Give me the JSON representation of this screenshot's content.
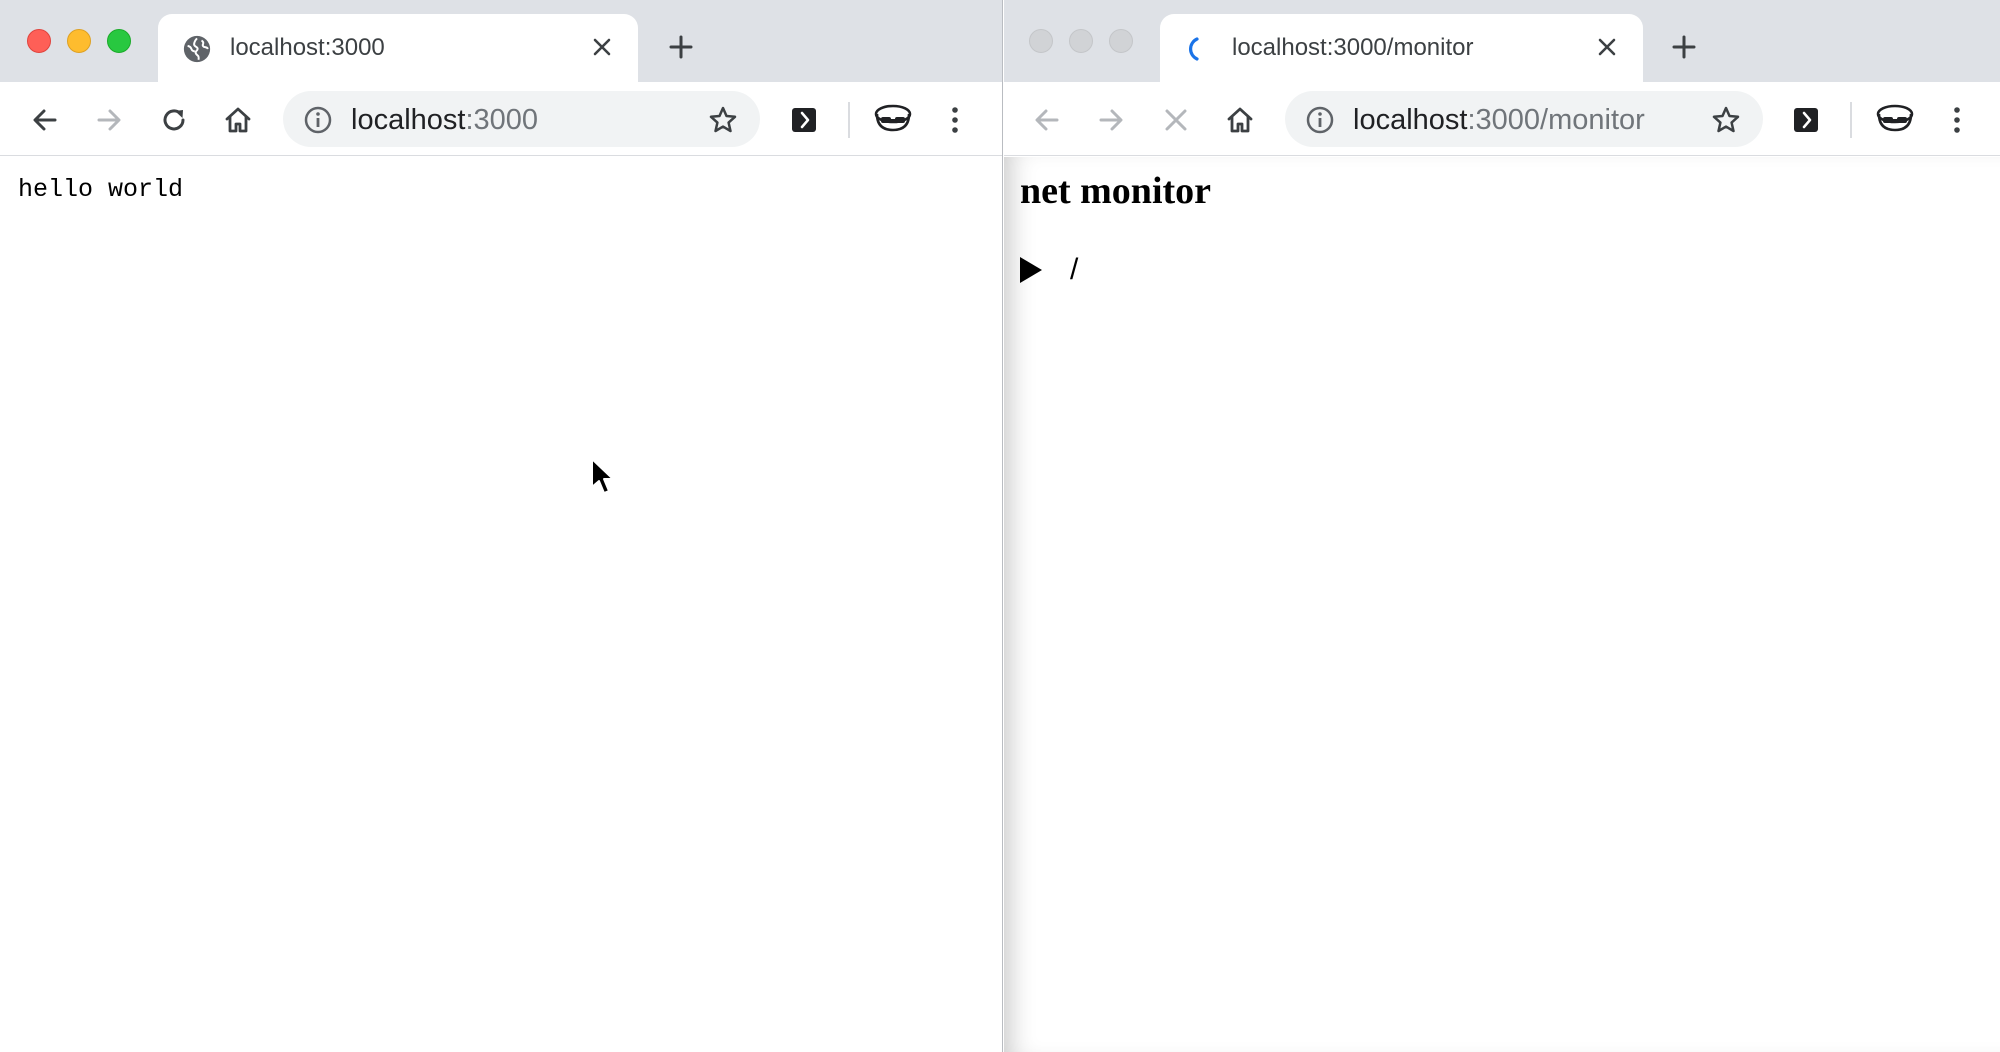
{
  "left_window": {
    "tab": {
      "title": "localhost:3000",
      "icon": "globe-icon"
    },
    "address": {
      "host": "localhost",
      "rest": ":3000"
    },
    "content": {
      "text": "hello world"
    }
  },
  "right_window": {
    "tab": {
      "title": "localhost:3000/monitor",
      "icon": "loading-spinner-icon"
    },
    "address": {
      "host": "localhost",
      "rest": ":3000/monitor"
    },
    "content": {
      "heading": "net monitor",
      "requests": [
        {
          "path": "/"
        }
      ]
    }
  },
  "icons": {
    "toolbar": [
      "back-arrow-icon",
      "forward-arrow-icon",
      "reload-icon",
      "stop-icon",
      "home-icon",
      "info-icon",
      "star-icon",
      "extension-icon",
      "profile-icon",
      "menu-icon"
    ],
    "traffic_lights": [
      "close-dot",
      "minimize-dot",
      "zoom-dot"
    ],
    "pointer": "mouse-cursor-icon"
  },
  "colors": {
    "tabstrip": "#dee1e6",
    "close_light": "#fe5f57",
    "minimize_light": "#febc2e",
    "zoom_light": "#28c840",
    "spinner": "#1a73e8"
  }
}
